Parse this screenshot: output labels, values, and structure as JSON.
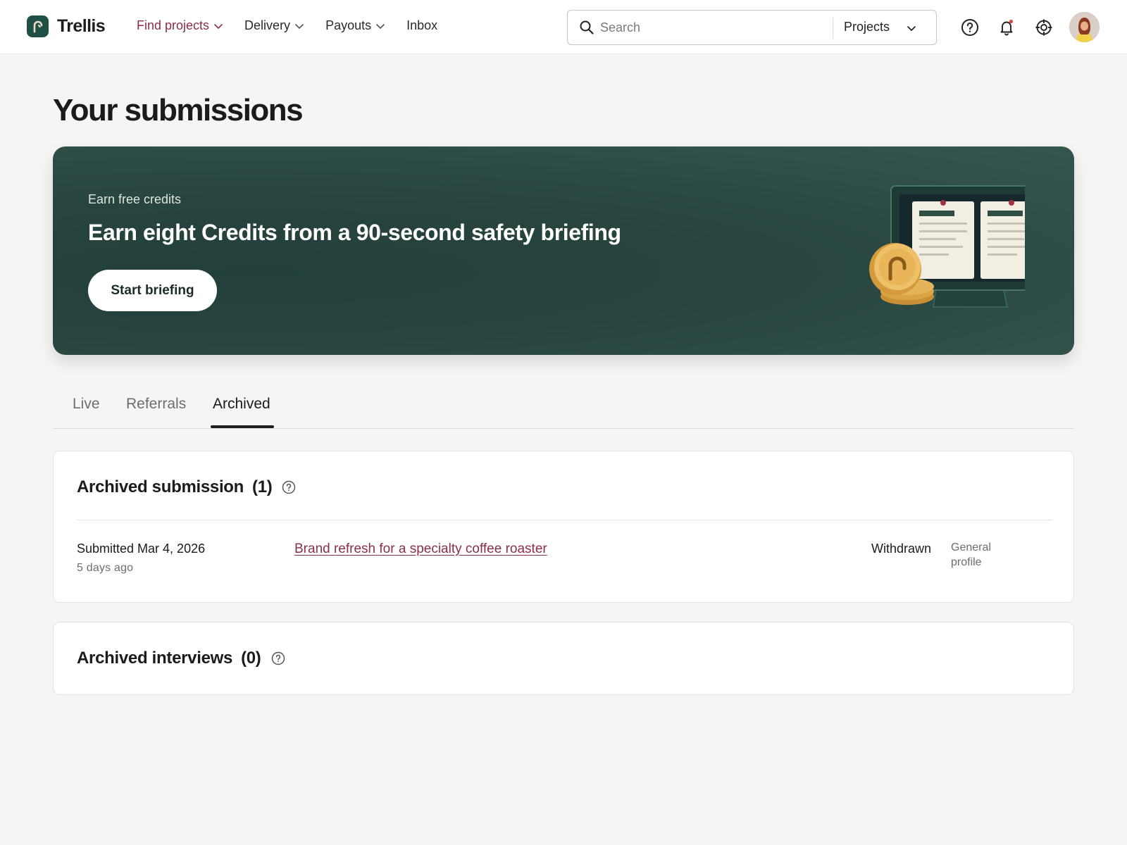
{
  "app": {
    "name": "Trellis"
  },
  "nav": {
    "items": [
      {
        "label": "Find projects",
        "has_dropdown": true,
        "active": true
      },
      {
        "label": "Delivery",
        "has_dropdown": true,
        "active": false
      },
      {
        "label": "Payouts",
        "has_dropdown": true,
        "active": false
      },
      {
        "label": "Inbox",
        "has_dropdown": false,
        "active": false
      }
    ]
  },
  "search": {
    "placeholder": "Search",
    "scope": "Projects"
  },
  "header_icons": [
    "help-icon",
    "bell-icon",
    "target-icon"
  ],
  "page": {
    "title": "Your submissions"
  },
  "banner": {
    "eyebrow": "Earn free credits",
    "title": "Earn eight Credits from a 90-second safety briefing",
    "button": "Start briefing"
  },
  "tabs": [
    {
      "label": "Live",
      "active": false
    },
    {
      "label": "Referrals",
      "active": false
    },
    {
      "label": "Archived",
      "active": true
    }
  ],
  "archived_submissions": {
    "title": "Archived submission",
    "count": "(1)",
    "rows": [
      {
        "submitted": "Submitted Mar 4, 2026",
        "ago": "5 days ago",
        "project": "Brand refresh for a specialty coffee roaster",
        "status": "Withdrawn",
        "profile": "General profile"
      }
    ]
  },
  "archived_interviews": {
    "title": "Archived interviews",
    "count": "(0)"
  },
  "colors": {
    "accent": "#8a2f47",
    "banner_bg": "#2c4a44",
    "brand_logo": "#1f4f45",
    "page_bg": "#f6f5f3"
  }
}
